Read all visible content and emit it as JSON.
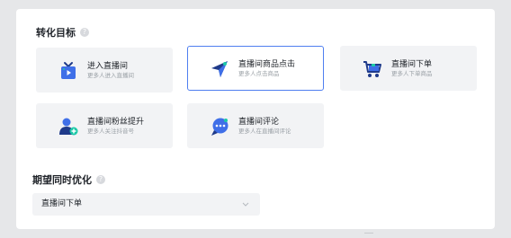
{
  "conversion_goal": {
    "title": "转化目标",
    "help_icon": "help-circle-icon",
    "cards": [
      {
        "title": "进入直播间",
        "desc": "更多人进入直播间",
        "icon": "tv-icon",
        "selected": false
      },
      {
        "title": "直播间商品点击",
        "desc": "更多人点击商品",
        "icon": "cursor-arrow-icon",
        "selected": true
      },
      {
        "title": "直播间下单",
        "desc": "更多人下单商品",
        "icon": "shopping-cart-icon",
        "selected": false
      },
      {
        "title": "直播间粉丝提升",
        "desc": "更多人关注抖音号",
        "icon": "user-add-icon",
        "selected": false
      },
      {
        "title": "直播间评论",
        "desc": "更多人在直播间评论",
        "icon": "chat-bubble-icon",
        "selected": false
      }
    ]
  },
  "expected_optimization": {
    "title": "期望同时优化",
    "help_icon": "help-circle-icon",
    "select": {
      "value": "直播间下单",
      "icon": "chevron-down-icon"
    }
  },
  "colors": {
    "accent": "#4f7ff0",
    "icon_blue": "#3f6fe8",
    "icon_dark": "#1f3a8a",
    "icon_teal": "#1ec9a8",
    "card_bg": "#f2f3f5",
    "page_bg": "#e6e7e9"
  }
}
